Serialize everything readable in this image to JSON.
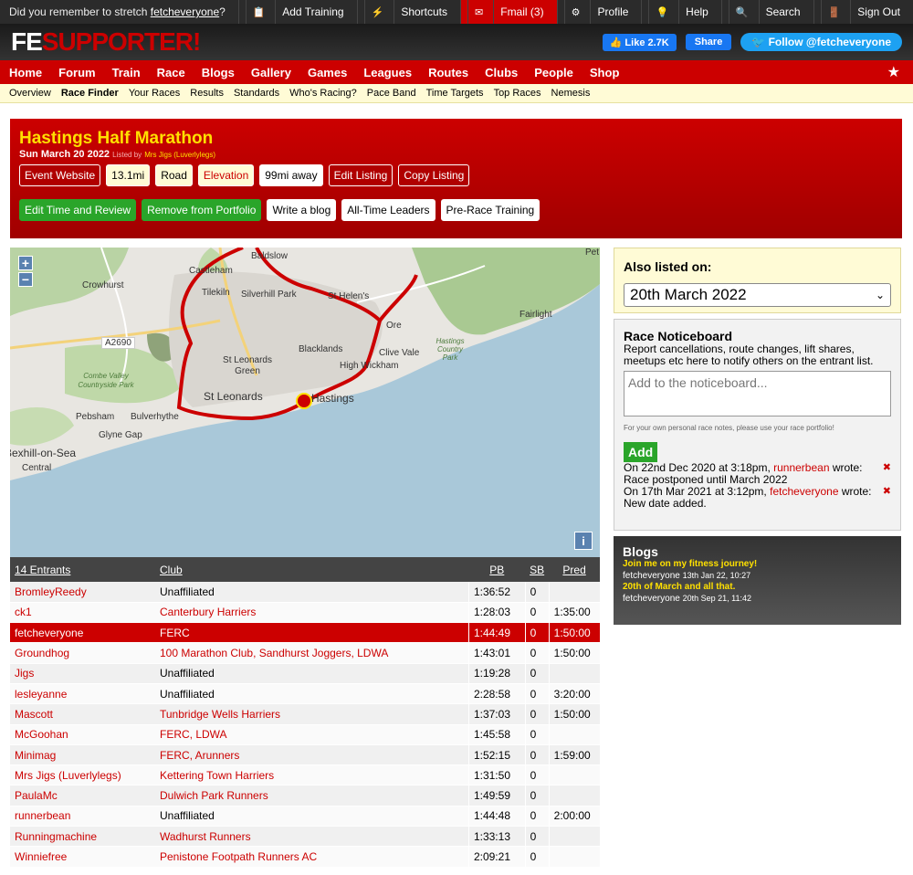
{
  "topbar": {
    "message_prefix": "Did you remember to stretch ",
    "message_user": "fetcheveryone",
    "message_suffix": "?",
    "links": [
      {
        "icon": "clipboard-icon",
        "glyph": "📋",
        "label": "Add Training"
      },
      {
        "icon": "lightning-icon",
        "glyph": "⚡",
        "label": "Shortcuts"
      },
      {
        "icon": "mail-icon",
        "glyph": "✉",
        "label": "Fmail (3)"
      },
      {
        "icon": "gear-icon",
        "glyph": "⚙",
        "label": "Profile"
      },
      {
        "icon": "lightbulb-icon",
        "glyph": "💡",
        "label": "Help"
      },
      {
        "icon": "search-icon",
        "glyph": "🔍",
        "label": "Search"
      },
      {
        "icon": "door-icon",
        "glyph": "🚪",
        "label": "Sign Out"
      }
    ]
  },
  "header": {
    "logo_fe": "FE",
    "logo_supporter": "SUPPORTER!",
    "like_label": "Like 2.7K",
    "share_label": "Share",
    "follow_label": "Follow @fetcheveryone"
  },
  "mainnav": [
    "Home",
    "Forum",
    "Train",
    "Race",
    "Blogs",
    "Gallery",
    "Games",
    "Leagues",
    "Routes",
    "Clubs",
    "People",
    "Shop"
  ],
  "subnav": [
    "Overview",
    "Race Finder",
    "Your Races",
    "Results",
    "Standards",
    "Who's Racing?",
    "Pace Band",
    "Time Targets",
    "Top Races",
    "Nemesis"
  ],
  "subnav_active": "Race Finder",
  "event": {
    "title": "Hastings Half Marathon",
    "date": "Sun March 20 2022",
    "listed_by": "Listed by",
    "lister": "Mrs Jigs (Luverlylegs)",
    "pills_row1": [
      {
        "label": "Event Website",
        "style": "red"
      },
      {
        "label": "13.1mi",
        "style": "yellow"
      },
      {
        "label": "Road",
        "style": "yellow"
      },
      {
        "label": "Elevation",
        "style": "elev"
      },
      {
        "label": "99mi away",
        "style": "white"
      },
      {
        "label": "Edit Listing",
        "style": "red"
      },
      {
        "label": "Copy Listing",
        "style": "red"
      }
    ],
    "pills_row2": [
      {
        "label": "Edit Time and Review",
        "style": "green"
      },
      {
        "label": "Remove from Portfolio",
        "style": "green"
      },
      {
        "label": "Write a blog",
        "style": "white"
      },
      {
        "label": "All-Time Leaders",
        "style": "white"
      },
      {
        "label": "Pre-Race Training",
        "style": "white"
      }
    ]
  },
  "map": {
    "zoom_in": "+",
    "zoom_out": "−",
    "info": "i",
    "labels": [
      "Baldslow",
      "Castleham",
      "Crowhurst",
      "Tilekiln",
      "Silverhill Park",
      "St Helen's",
      "Ore",
      "Fairlight",
      "A2690",
      "Blacklands",
      "Clive Vale",
      "Hastings Country Park",
      "High Wickham",
      "St Leonards Green",
      "Combe Valley Countryside Park",
      "St Leonards",
      "Hastings",
      "Pebsham",
      "Bulverhythe",
      "Glyne Gap",
      "Bexhill-on-Sea",
      "Central",
      "Pet"
    ]
  },
  "table": {
    "headers": {
      "name": "14 Entrants",
      "club": "Club",
      "pb": "PB",
      "sb": "SB",
      "pred": "Pred"
    },
    "rows": [
      {
        "name": "BromleyReedy",
        "club": "Unaffiliated",
        "pb": "1:36:52",
        "sb": "0",
        "pred": ""
      },
      {
        "name": "ck1",
        "club": "Canterbury Harriers",
        "pb": "1:28:03",
        "sb": "0",
        "pred": "1:35:00"
      },
      {
        "name": "fetcheveryone",
        "club": "FERC",
        "pb": "1:44:49",
        "sb": "0",
        "pred": "1:50:00",
        "me": true
      },
      {
        "name": "Groundhog",
        "club": "100 Marathon Club, Sandhurst Joggers, LDWA",
        "pb": "1:43:01",
        "sb": "0",
        "pred": "1:50:00"
      },
      {
        "name": "Jigs",
        "club": "Unaffiliated",
        "pb": "1:19:28",
        "sb": "0",
        "pred": ""
      },
      {
        "name": "lesleyanne",
        "club": "Unaffiliated",
        "pb": "2:28:58",
        "sb": "0",
        "pred": "3:20:00"
      },
      {
        "name": "Mascott",
        "club": "Tunbridge Wells Harriers",
        "pb": "1:37:03",
        "sb": "0",
        "pred": "1:50:00"
      },
      {
        "name": "McGoohan",
        "club": "FERC, LDWA",
        "pb": "1:45:58",
        "sb": "0",
        "pred": ""
      },
      {
        "name": "Minimag",
        "club": "FERC, Arunners",
        "pb": "1:52:15",
        "sb": "0",
        "pred": "1:59:00"
      },
      {
        "name": "Mrs Jigs (Luverlylegs)",
        "club": "Kettering Town Harriers",
        "pb": "1:31:50",
        "sb": "0",
        "pred": ""
      },
      {
        "name": "PaulaMc",
        "club": "Dulwich Park Runners",
        "pb": "1:49:59",
        "sb": "0",
        "pred": ""
      },
      {
        "name": "runnerbean",
        "club": "Unaffiliated",
        "pb": "1:44:48",
        "sb": "0",
        "pred": "2:00:00"
      },
      {
        "name": "Runningmachine",
        "club": "Wadhurst Runners",
        "pb": "1:33:13",
        "sb": "0",
        "pred": ""
      },
      {
        "name": "Winniefree",
        "club": "Penistone Footpath Runners AC",
        "pb": "2:09:21",
        "sb": "0",
        "pred": ""
      }
    ]
  },
  "also_listed": {
    "title": "Also listed on:",
    "selected": "20th March 2022"
  },
  "noticeboard": {
    "title": "Race Noticeboard",
    "description": "Report cancellations, route changes, lift shares, meetups etc here to notify others on the entrant list.",
    "placeholder": "Add to the noticeboard...",
    "fine_print": "For your own personal race notes, please use your race portfolio!",
    "add_label": "Add",
    "entries": [
      {
        "prefix": "On 22nd Dec 2020 at 3:18pm, ",
        "who": "runnerbean",
        "suffix": " wrote:",
        "text": "Race postponed until March 2022"
      },
      {
        "prefix": "On 17th Mar 2021 at 3:12pm, ",
        "who": "fetcheveryone",
        "suffix": " wrote:",
        "text": "New date added."
      }
    ]
  },
  "blogs": {
    "title": "Blogs",
    "items": [
      {
        "title": "Join me on my fitness journey!",
        "author": "fetcheveryone",
        "date": "13th Jan 22, 10:27"
      },
      {
        "title": "20th of March and all that.",
        "author": "fetcheveryone",
        "date": "20th Sep 21, 11:42"
      }
    ]
  },
  "colors": {
    "brand_red": "#cc0000",
    "accent_yellow": "#ffe000",
    "green": "#2aa52a"
  }
}
